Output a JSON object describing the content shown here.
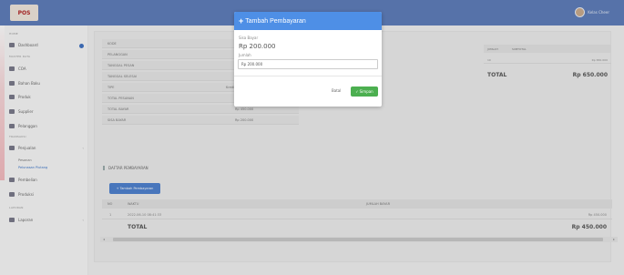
{
  "topbar": {
    "logo_text": "POS",
    "user_name": "Kelas Cheer",
    "brand_color": "#5b7ab9"
  },
  "sidebar": {
    "heading_main": "HOME",
    "dashboard": "Dashboard",
    "heading_master": "MASTER DATA",
    "items_master": [
      "COA",
      "Bahan Baku",
      "Produk",
      "Supplier",
      "Pelanggan"
    ],
    "heading_transaksi": "TRANSAKSI",
    "penjualan": "Penjualan",
    "sub_penjualan": [
      "Pesanan",
      "Pelunasan Piutang"
    ],
    "pembelian": "Pembelian",
    "produksi": "Produksi",
    "heading_laporan": "LAPORAN",
    "laporan": "Laporan"
  },
  "info": {
    "rows": [
      {
        "label": "KODE",
        "value": ""
      },
      {
        "label": "PELANGGAN",
        "value": ""
      },
      {
        "label": "TANGGAL PESAN",
        "value": ""
      },
      {
        "label": "TANGGAL SELESAI",
        "value": ""
      },
      {
        "label": "TIPE",
        "value": "Kredit"
      },
      {
        "label": "TOTAL PESANAN",
        "value": "Rp 650.000"
      },
      {
        "label": "TOTAL BAYAR",
        "value": "Rp 450.000"
      },
      {
        "label": "SISA BAYAR",
        "value": "Rp 200.000"
      }
    ]
  },
  "detail": {
    "col_jumlah": "JUMLAH",
    "col_subtotal": "SUBTOTAL",
    "row_jumlah": "10",
    "row_subtotal": "Rp 650.000",
    "total_label": "TOTAL",
    "total_value": "Rp 650.000"
  },
  "daftar": {
    "title": "DAFTAR PEMBAYARAN",
    "add_button": "+ Tambah Pembayaran",
    "col_no": "NO",
    "col_waktu": "WAKTU",
    "col_jumlah": "JUMLAH BAYAR",
    "rows": [
      {
        "no": "1",
        "waktu": "2022-06-10 08:41:33",
        "jumlah": "Rp 450.000"
      }
    ],
    "total_label": "TOTAL",
    "total_value": "Rp 450.000"
  },
  "modal": {
    "title": "Tambah Pembayaran",
    "sisa_label": "Sisa Bayar",
    "sisa_value": "Rp 200.000",
    "jumlah_label": "Jumlah",
    "jumlah_value": "Rp 200.000",
    "batal_label": "Batal",
    "simpan_label": "Simpan",
    "header_color": "#4e8fe6",
    "simpan_color": "#4caf50"
  }
}
